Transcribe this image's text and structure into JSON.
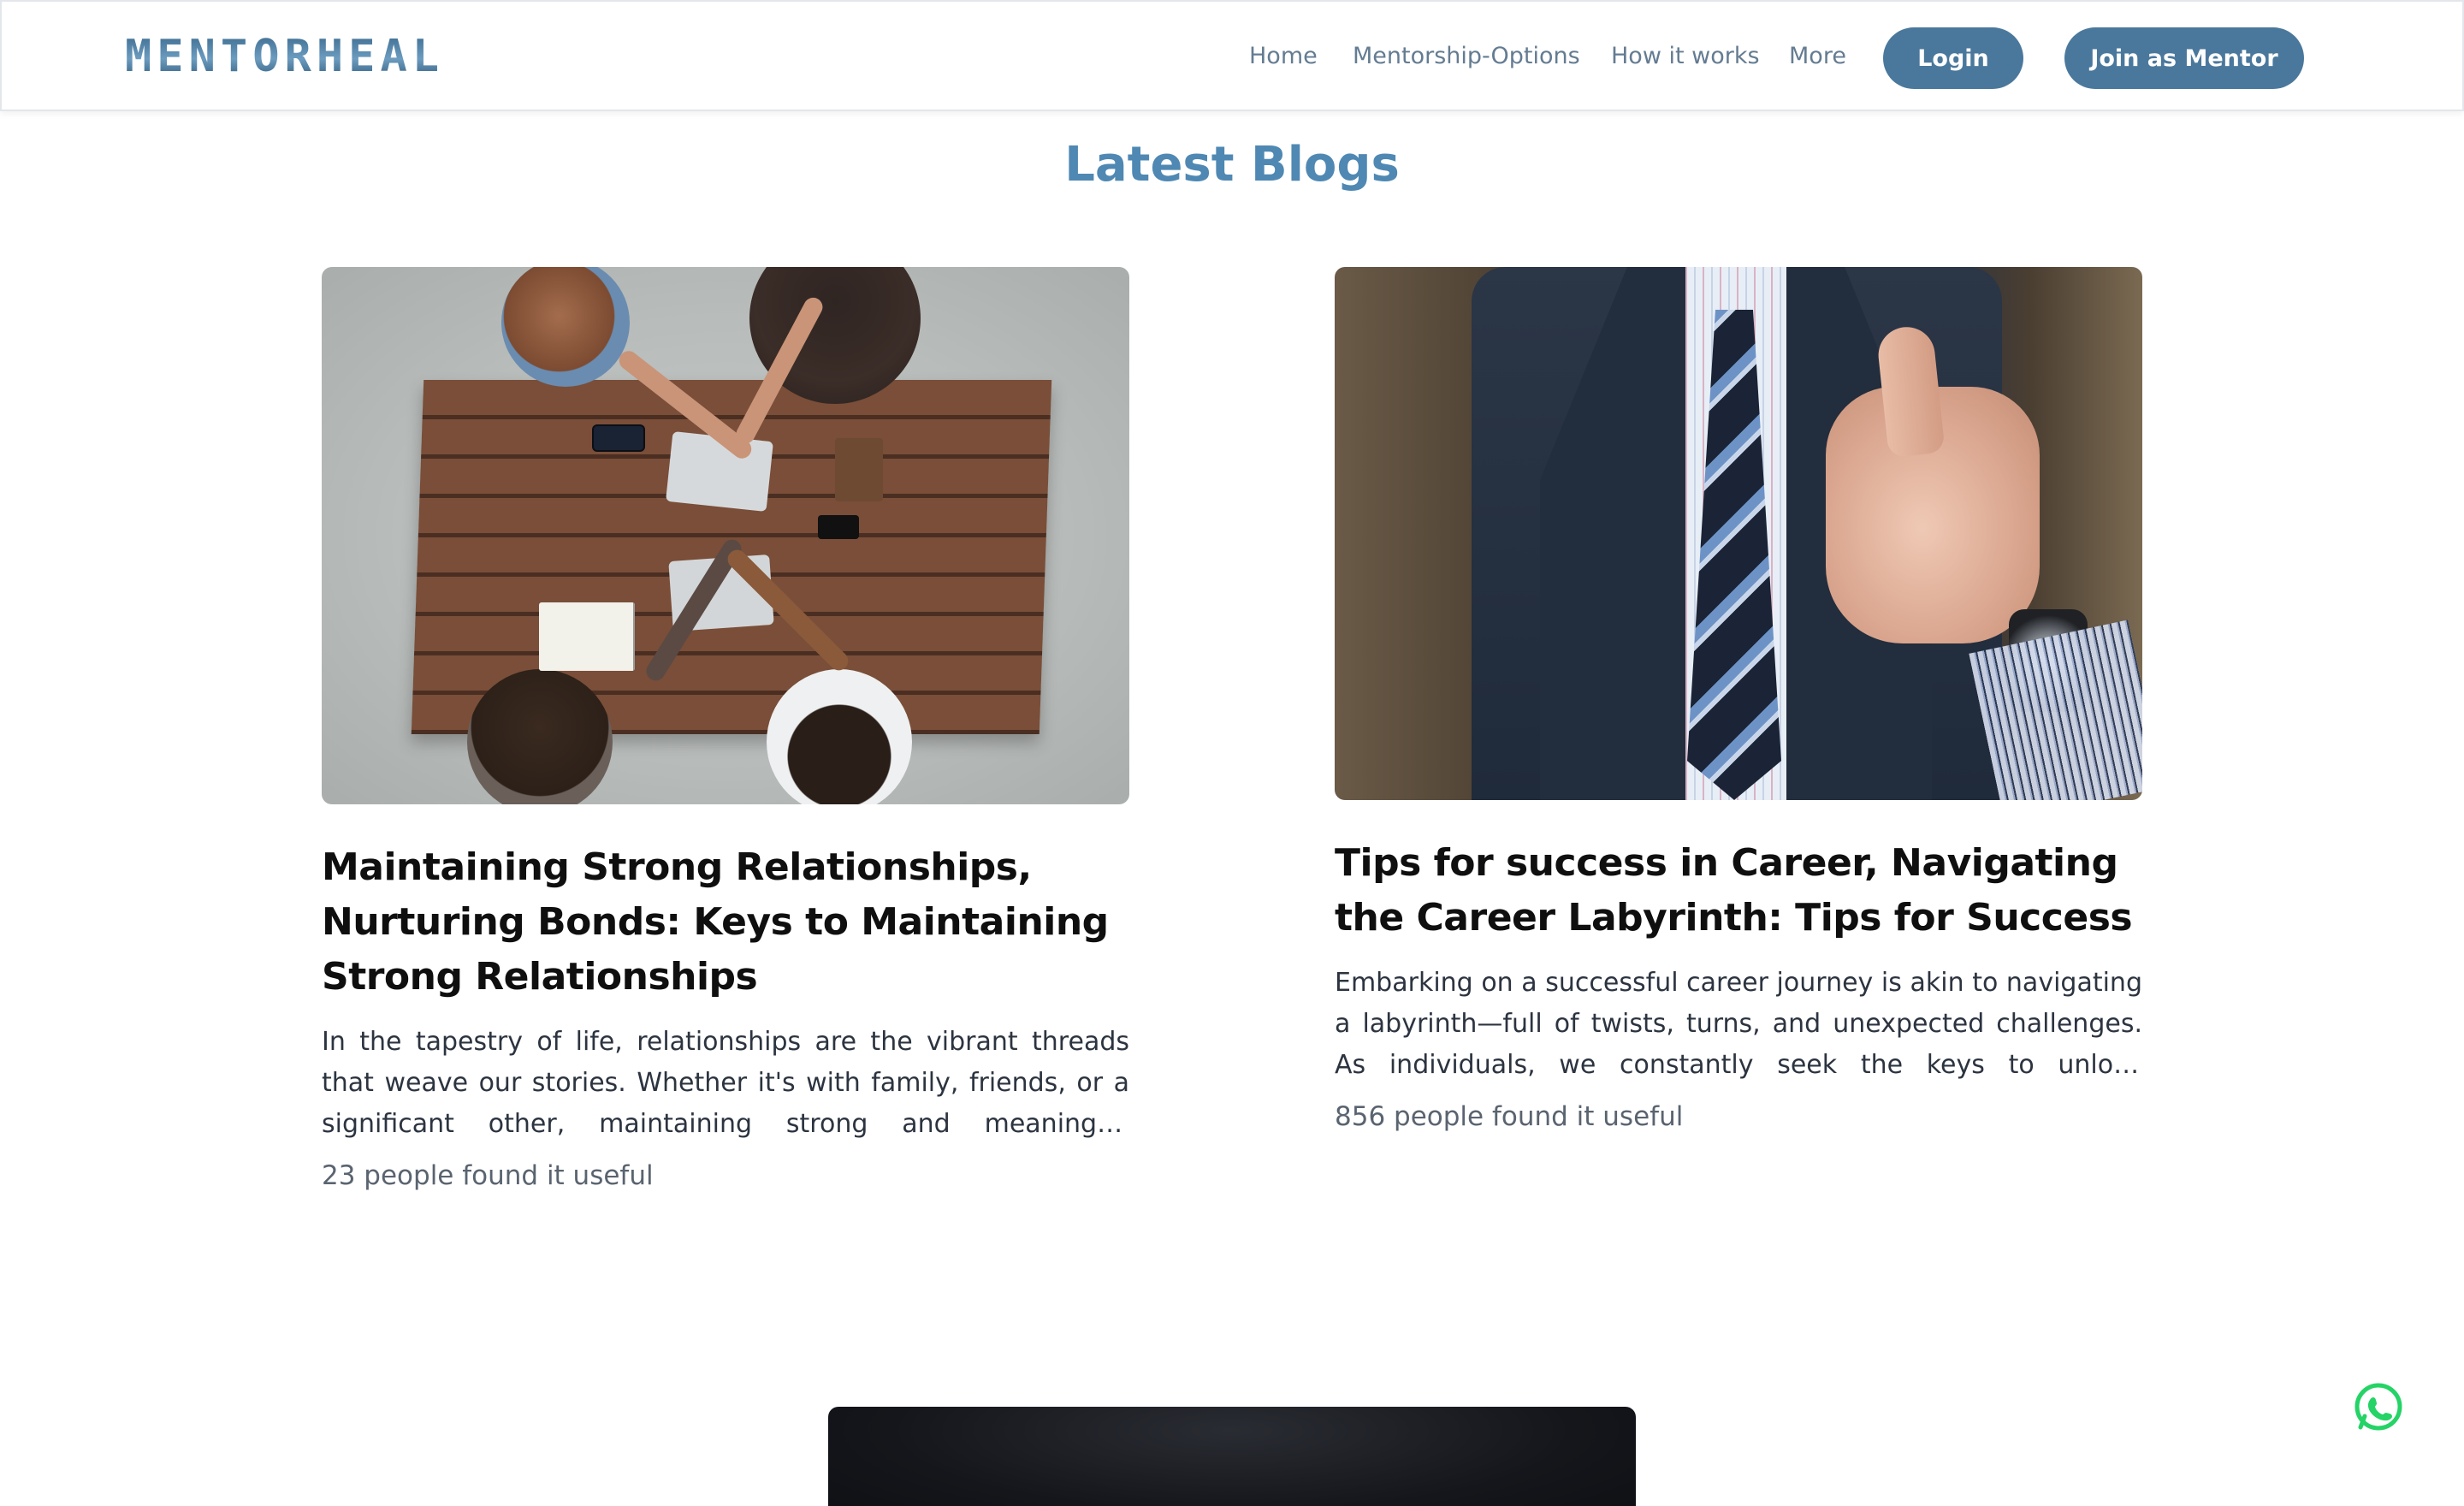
{
  "brand": {
    "logo_text": "MENTORHEAL",
    "accent": "#4a789c",
    "title_color": "#4f88b3"
  },
  "nav": {
    "links": [
      "Home",
      "Mentorship-Options",
      "How it works",
      "More"
    ],
    "login_label": "Login",
    "join_label": "Join as Mentor"
  },
  "section": {
    "title": "Latest Blogs"
  },
  "blogs": [
    {
      "image": "team-fist-bump-top-view",
      "title": "Maintaining Strong Relationships, Nurturing Bonds: Keys to Maintaining Strong Relationships",
      "excerpt": "In the tapestry of life, relationships are the vibrant threads that weave our stories. Whether it's with family, friends, or a significant other, maintaining strong and meaningful connections requir...",
      "useful": "23 people found it useful"
    },
    {
      "image": "businessman-thumbs-up",
      "title": "Tips for success in Career, Navigating the Career Labyrinth: Tips for Success",
      "excerpt": "Embarking on a successful career journey is akin to navigating a labyrinth—full of twists, turns, and unexpected challenges. As individuals, we constantly seek the keys to unlock profession...",
      "useful": "856 people found it useful"
    }
  ],
  "floating": {
    "icon": "whatsapp-icon",
    "color": "#25d366"
  }
}
